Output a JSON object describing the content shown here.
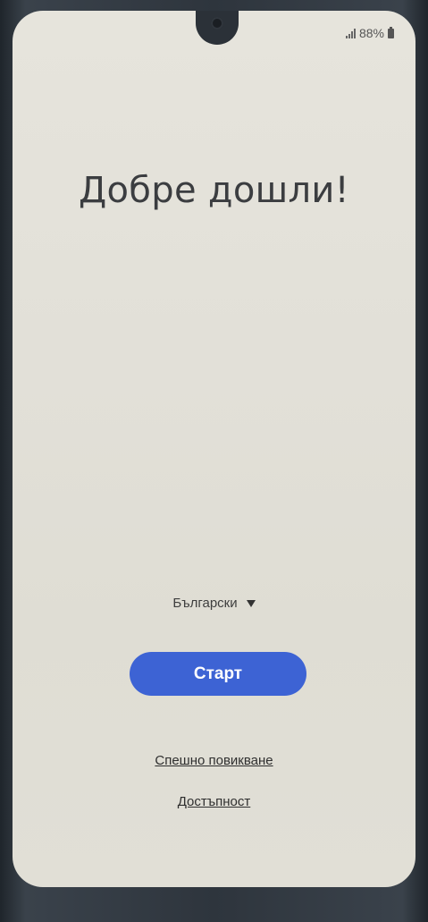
{
  "status_bar": {
    "signal_icon": "signal-bars-icon",
    "battery_text": "88%",
    "battery_icon": "battery-icon"
  },
  "welcome": {
    "title": "Добре дошли!"
  },
  "language": {
    "selected": "Български",
    "dropdown_icon": "triangle-down-icon"
  },
  "actions": {
    "start_label": "Старт",
    "emergency_call_label": "Спешно повикване",
    "accessibility_label": "Достъпност"
  },
  "colors": {
    "accent": "#3d63d4",
    "screen_background": "#e2e0d8",
    "bezel": "#2b3138"
  }
}
